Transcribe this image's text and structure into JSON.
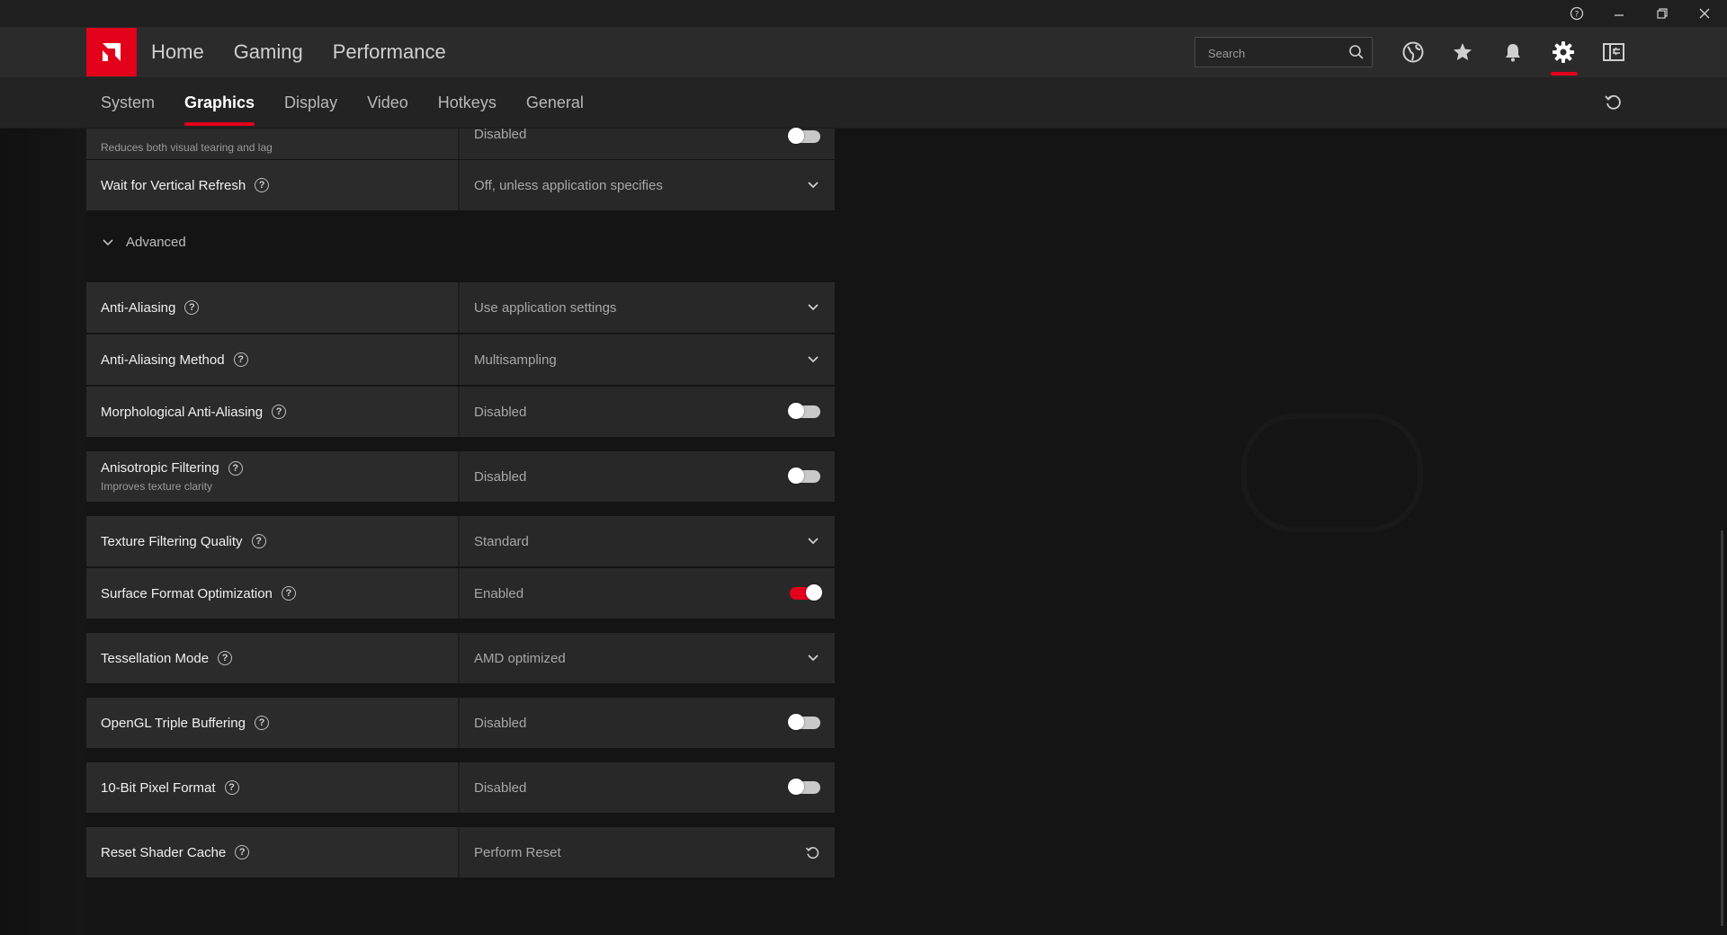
{
  "header": {
    "nav": [
      "Home",
      "Gaming",
      "Performance"
    ],
    "search_placeholder": "Search"
  },
  "subnav": {
    "tabs": [
      "System",
      "Graphics",
      "Display",
      "Video",
      "Hotkeys",
      "General"
    ],
    "active": "Graphics"
  },
  "settings": {
    "partial_row": {
      "desc": "Reduces both visual tearing and lag",
      "value": "Disabled"
    },
    "vertical_refresh": {
      "label": "Wait for Vertical Refresh",
      "value": "Off, unless application specifies"
    },
    "advanced_label": "Advanced",
    "anti_aliasing": {
      "label": "Anti-Aliasing",
      "value": "Use application settings"
    },
    "aa_method": {
      "label": "Anti-Aliasing Method",
      "value": "Multisampling"
    },
    "morph_aa": {
      "label": "Morphological Anti-Aliasing",
      "value": "Disabled"
    },
    "aniso": {
      "label": "Anisotropic Filtering",
      "desc": "Improves texture clarity",
      "value": "Disabled"
    },
    "texture_quality": {
      "label": "Texture Filtering Quality",
      "value": "Standard"
    },
    "surface_format": {
      "label": "Surface Format Optimization",
      "value": "Enabled"
    },
    "tessellation": {
      "label": "Tessellation Mode",
      "value": "AMD optimized"
    },
    "opengl_triple": {
      "label": "OpenGL Triple Buffering",
      "value": "Disabled"
    },
    "ten_bit": {
      "label": "10-Bit Pixel Format",
      "value": "Disabled"
    },
    "shader_cache": {
      "label": "Reset Shader Cache",
      "value": "Perform Reset"
    }
  },
  "colors": {
    "accent": "#e2001a",
    "background": "#141414",
    "row": "#2a2a2a"
  }
}
